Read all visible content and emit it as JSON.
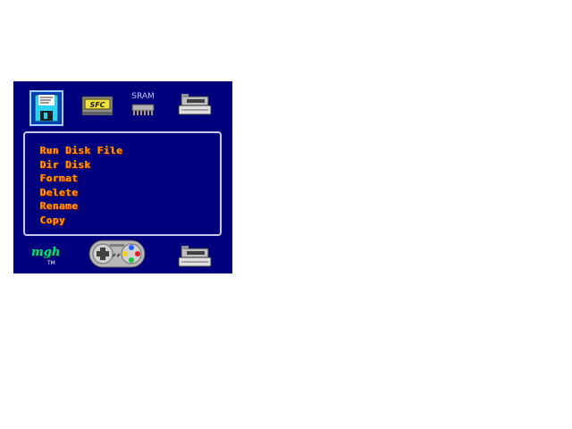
{
  "top_bar": {
    "sram_label": "SRAM"
  },
  "menu": {
    "items": [
      "Run Disk File",
      "Dir Disk",
      "Format",
      "Delete",
      "Rename",
      "Copy"
    ]
  },
  "logo": {
    "text": "mgh",
    "sub": "TM"
  },
  "icons": {
    "floppy": "floppy-disk-icon",
    "cartridge": "sfc-cartridge-icon",
    "sram": "sram-chip-icon",
    "tape": "tape-drive-icon",
    "gamepad": "gamepad-icon"
  },
  "colors": {
    "background": "#00007f",
    "menu_text": "#ff9000",
    "selected_border": "#9fd0ff",
    "panel_border": "#c8c8e8"
  }
}
